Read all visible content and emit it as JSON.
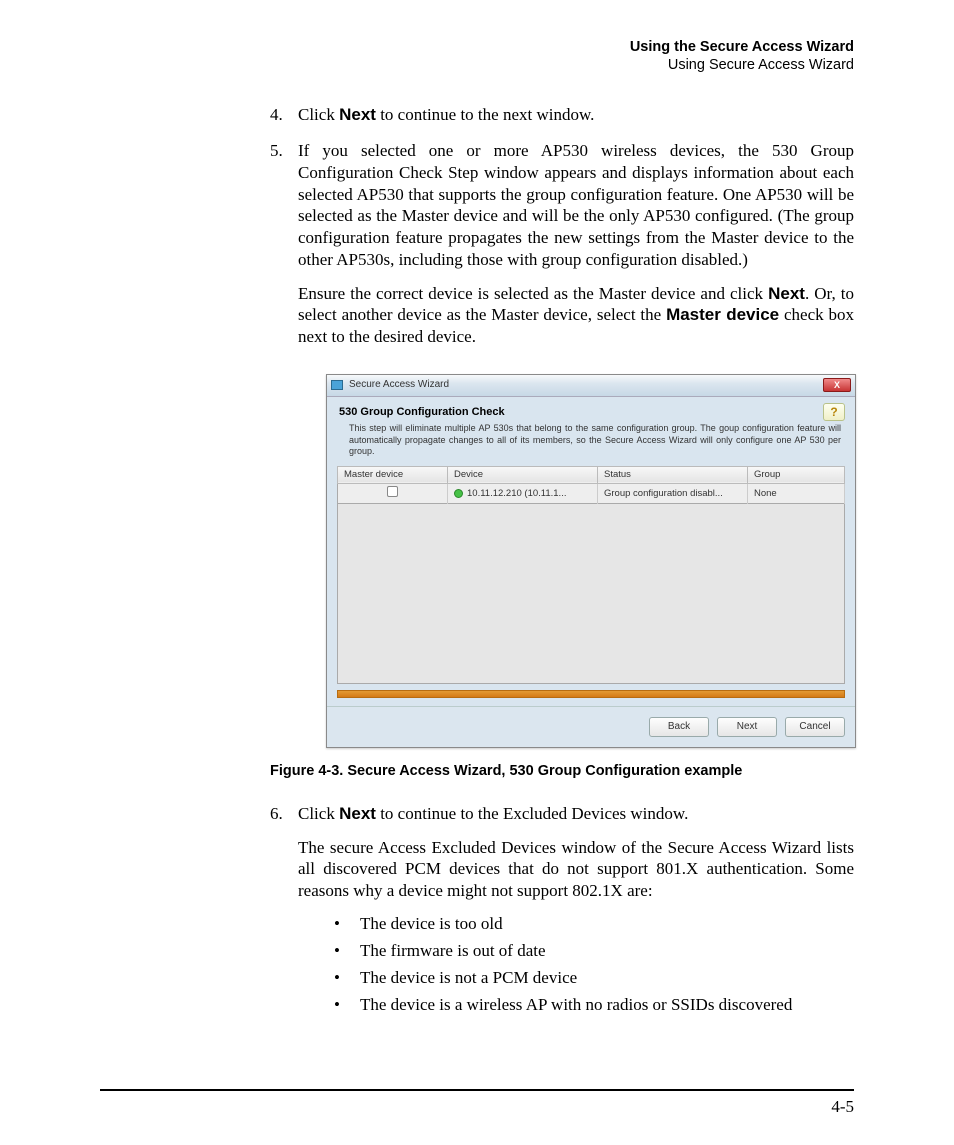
{
  "header": {
    "line1": "Using the Secure Access Wizard",
    "line2": "Using Secure Access Wizard"
  },
  "step4": {
    "num": "4.",
    "pre": "Click ",
    "bold": "Next",
    "post": " to continue to the next window."
  },
  "step5": {
    "num": "5.",
    "body": "If you selected one or more AP530 wireless devices, the 530 Group Configuration Check Step window appears and displays information about each selected AP530 that supports the group configuration feature. One AP530 will be selected as the Master device and will be the only AP530 configured. (The group configuration feature propagates the new settings from the Master device to the other AP530s, including those with group configuration disabled.)",
    "p2_pre": "Ensure the correct device is selected as the Master device and click ",
    "p2_b1": "Next",
    "p2_mid": ". Or, to select another device as the Master device, select the ",
    "p2_b2": "Master device",
    "p2_post": " check box next to the desired device."
  },
  "dialog": {
    "title": "Secure Access Wizard",
    "close": "X",
    "heading": "530 Group Configuration Check",
    "help": "?",
    "note": "This step will eliminate multiple AP 530s that belong to the same configuration group. The goup configuration feature will automatically propagate changes to all of its members, so the Secure Access Wizard will only configure one AP 530 per group.",
    "cols": {
      "c1": "Master device",
      "c2": "Device",
      "c3": "Status",
      "c4": "Group"
    },
    "row": {
      "device": "10.11.12.210 (10.11.1...",
      "status": "Group configuration disabl...",
      "group": "None"
    },
    "buttons": {
      "back": "Back",
      "next": "Next",
      "cancel": "Cancel"
    }
  },
  "caption": "Figure 4-3. Secure Access Wizard, 530 Group Configuration example",
  "step6": {
    "num": "6.",
    "pre": "Click ",
    "bold": "Next",
    "post": " to continue to the Excluded Devices window.",
    "p2": "The secure Access Excluded Devices window of the Secure Access Wizard lists all discovered PCM devices that do not support 801.X authentication. Some reasons why a device might not support 802.1X are:",
    "bullets": [
      "The device is too old",
      "The firmware is out of date",
      "The device is not a PCM device",
      "The device is a wireless AP with no radios or SSIDs discovered"
    ]
  },
  "pagenum": "4-5"
}
